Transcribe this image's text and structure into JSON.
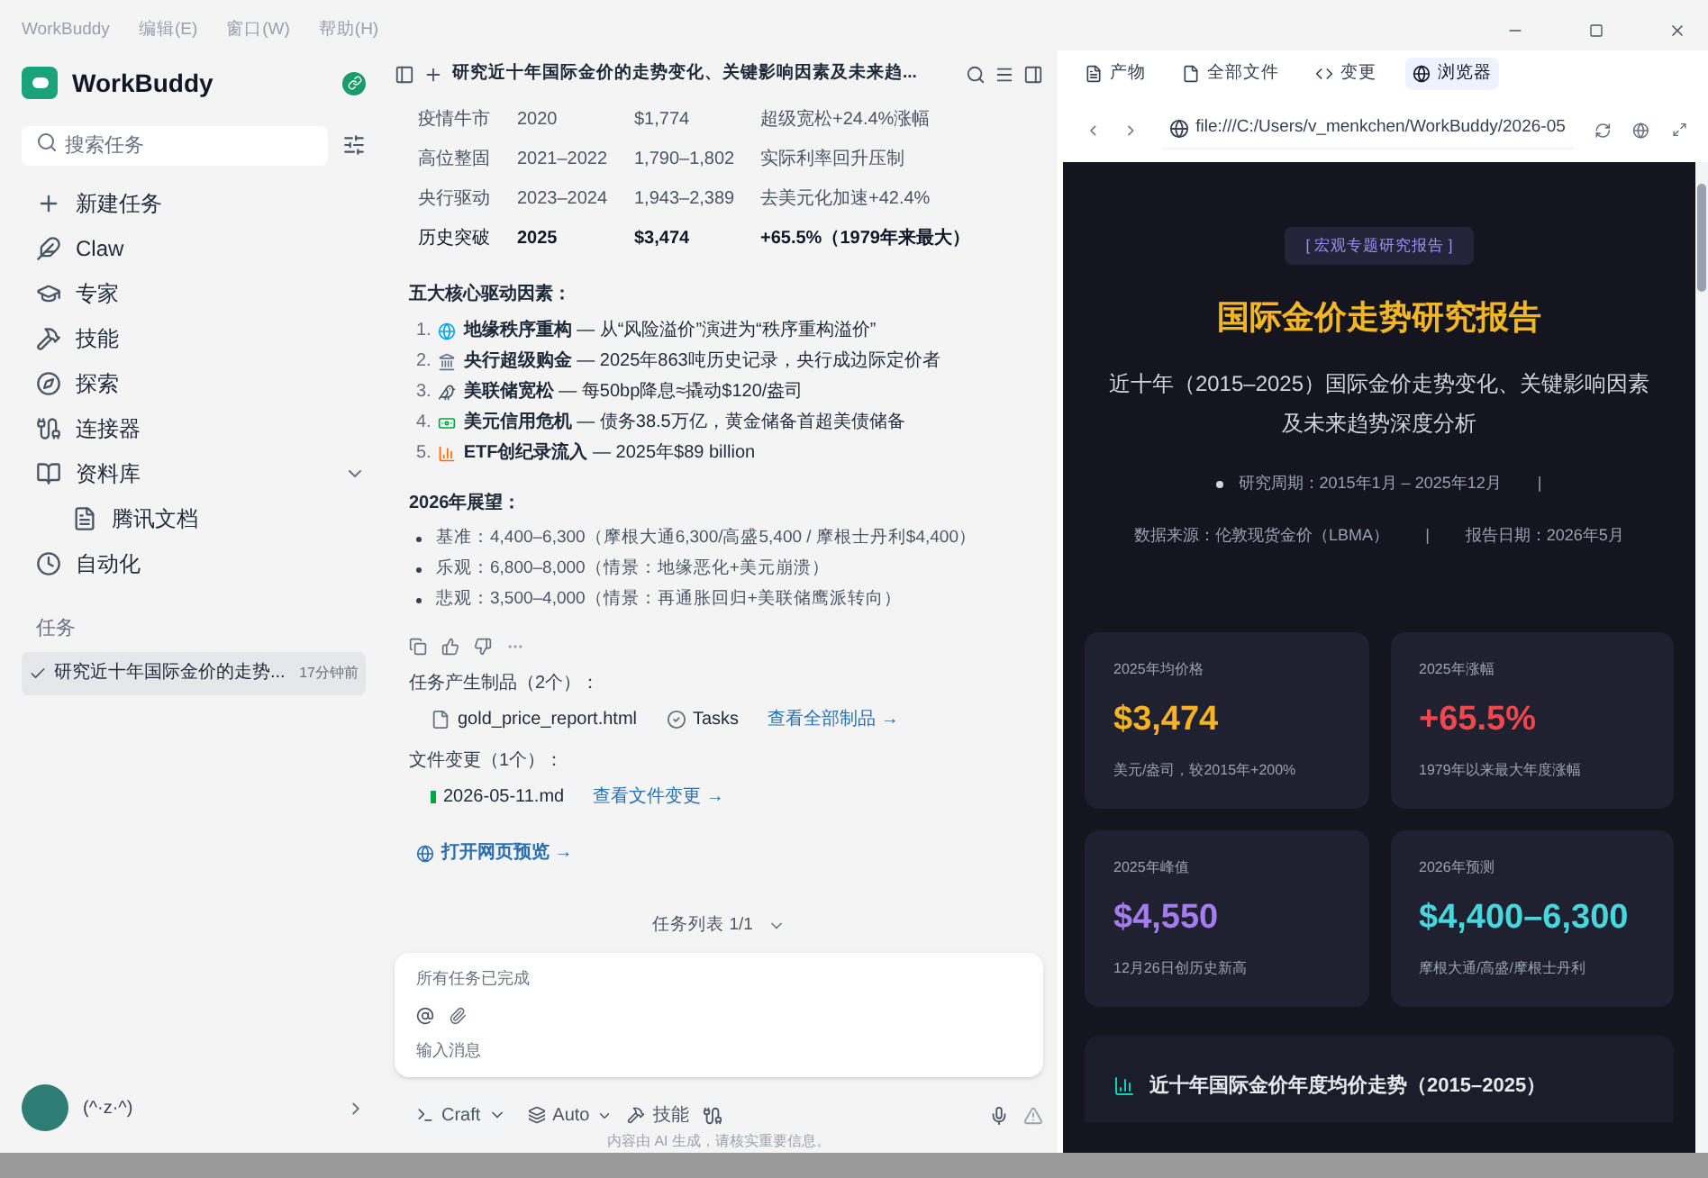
{
  "menu_bar": {
    "app_name": "WorkBuddy",
    "menus": [
      "编辑(E)",
      "窗口(W)",
      "帮助(H)"
    ]
  },
  "sidebar": {
    "logo_text": "WorkBuddy",
    "search": {
      "placeholder": "搜索任务"
    },
    "nav": [
      {
        "kind": "new",
        "label": "新建任务"
      },
      {
        "kind": "claw",
        "label": "Claw"
      },
      {
        "kind": "expert",
        "label": "专家"
      },
      {
        "kind": "skill",
        "label": "技能"
      },
      {
        "kind": "explore",
        "label": "探索"
      },
      {
        "kind": "connector",
        "label": "连接器"
      },
      {
        "kind": "library",
        "label": "资料库",
        "expanded": true,
        "children": [
          {
            "kind": "doc",
            "label": "腾讯文档"
          }
        ]
      },
      {
        "kind": "auto",
        "label": "自动化"
      }
    ],
    "section_title": "任务",
    "tasks": [
      {
        "title": "研究近十年国际金价的走势...",
        "time": "17分钟前",
        "selected": true
      }
    ],
    "user": {
      "name": "(^·z·^)"
    }
  },
  "chat": {
    "title": "研究近十年国际金价的走势变化、关键影响因素及未来趋...",
    "table_rows": [
      [
        "疫情牛市",
        "2020",
        "$1,774",
        "超级宽松+24.4%涨幅"
      ],
      [
        "高位整固",
        "2021–2022",
        "1,790–1,802",
        "实际利率回升压制"
      ],
      [
        "央行驱动",
        "2023–2024",
        "1,943–2,389",
        "去美元化加速+42.4%"
      ],
      [
        "历史突破",
        "2025",
        "$3,474",
        "+65.5%（1979年来最大）"
      ]
    ],
    "factors_heading": "五大核心驱动因素：",
    "factors": [
      {
        "num": "1.",
        "kind": "globe",
        "text": "**地缘秩序重构** — 从“风险溢价”演进为“秩序重构溢价”"
      },
      {
        "num": "2.",
        "kind": "bank",
        "text": "**央行超级购金** — 2025年863吨历史记录，央行成边际定价者"
      },
      {
        "num": "3.",
        "kind": "eagle",
        "text": "**美联储宽松** — 每50bp降息≈撬动$120/盎司"
      },
      {
        "num": "4.",
        "kind": "money",
        "text": "**美元信用危机** — 债务38.5万亿，黄金储备首超美债储备"
      },
      {
        "num": "5.",
        "kind": "chart",
        "text": "**ETF创纪录流入** — 2025年$89 billion"
      }
    ],
    "outlook_heading": "2026年展望：",
    "outlook": [
      "基准：4,400–6,300（摩根大通6,300/高盛5,400 / 摩根士丹利$4,400）",
      "乐观：6,800–8,000（情景：地缘恶化+美元崩溃）",
      "悲观：3,500–4,000（情景：再通胀回归+美联储鹰派转向）"
    ],
    "artifacts_heading": "任务产生制品（2个）：",
    "artifacts": [
      {
        "kind": "file",
        "name": "gold_price_report.html"
      },
      {
        "kind": "tasks",
        "name": "Tasks"
      }
    ],
    "artifacts_link": "查看全部制品 →",
    "changes_heading": "文件变更（1个）：",
    "changes": [
      {
        "name": "2026-05-11.md"
      }
    ],
    "changes_link": "查看文件变更 →",
    "preview_link": "打开网页预览 →",
    "task_list": "任务列表 1/1",
    "input": {
      "status": "所有任务已完成",
      "placeholder": "输入消息"
    },
    "toolbar": {
      "mode": "Craft",
      "model": "Auto",
      "skills": "技能"
    },
    "disclaimer": "内容由 AI 生成，请核实重要信息。"
  },
  "panel": {
    "tabs": [
      {
        "kind": "artifacts",
        "label": "产物",
        "selected": false
      },
      {
        "kind": "files",
        "label": "全部文件",
        "selected": false
      },
      {
        "kind": "changes",
        "label": "变更",
        "selected": false
      },
      {
        "kind": "browser",
        "label": "浏览器",
        "selected": true
      }
    ],
    "url": "file:///C:/Users/v_menkchen/WorkBuddy/2026-05",
    "report": {
      "badge": "[ 宏观专题研究报告 ]",
      "title": "国际金价走势研究报告",
      "subtitle": "近十年（2015–2025）国际金价走势变化、关键影响因素及未来趋势深度分析",
      "period": "研究周期：2015年1月 – 2025年12月",
      "source": "数据来源：伦敦现货金价（LBMA）",
      "date": "报告日期：2026年5月",
      "separators": [
        "|",
        "|"
      ],
      "cards": [
        {
          "label": "2025年均价格",
          "value": "$3,474",
          "note": "美元/盎司，较2015年+200%",
          "color": "#f5b324"
        },
        {
          "label": "2025年涨幅",
          "value": "+65.5%",
          "note": "1979年以来最大年度涨幅",
          "color": "#f0474f"
        },
        {
          "label": "2025年峰值",
          "value": "$4,550",
          "note": "12月26日创历史新高",
          "color": "#a57cf0"
        },
        {
          "label": "2026年预测",
          "value": "$4,400–6,300",
          "note": "摩根大通/高盛/摩根士丹利",
          "color": "#48d6dc"
        }
      ],
      "section_title": "近十年国际金价年度均价走势（2015–2025）"
    }
  }
}
